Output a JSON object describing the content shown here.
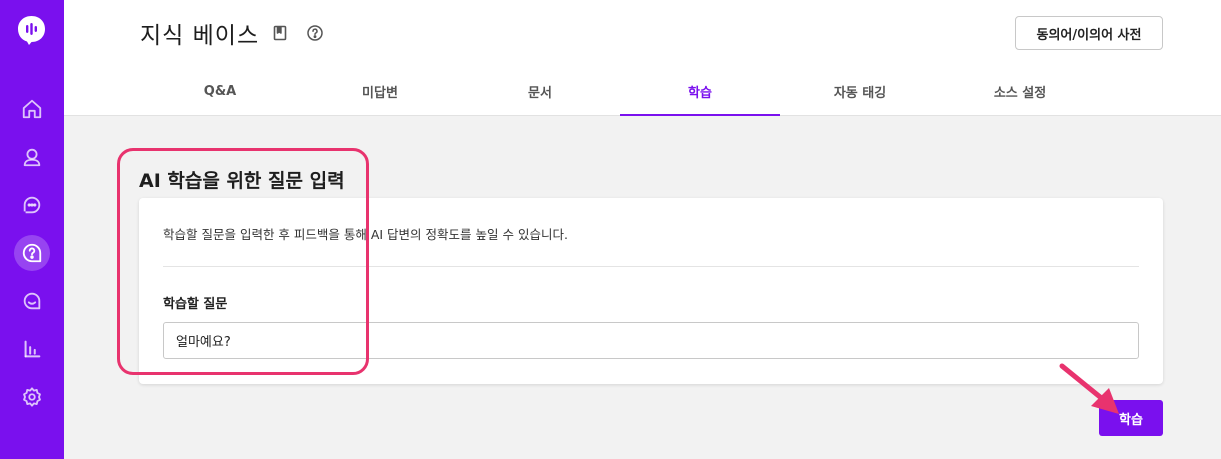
{
  "app": {
    "brand_color": "#7a10ee",
    "annotation_color": "#e8336e"
  },
  "sidebar": {
    "logo_icon": "chat-bubble-logo-icon",
    "items": [
      {
        "icon": "home-icon",
        "active": false
      },
      {
        "icon": "user-icon",
        "active": false
      },
      {
        "icon": "chat-icon",
        "active": false
      },
      {
        "icon": "knowledge-question-icon",
        "active": true
      },
      {
        "icon": "message-icon",
        "active": false
      },
      {
        "icon": "bar-chart-icon",
        "active": false
      },
      {
        "icon": "gear-icon",
        "active": false
      }
    ]
  },
  "header": {
    "title": "지식 베이스",
    "book_icon": "book-icon",
    "help_icon": "help-circle-icon",
    "dictionary_button": "동의어/이의어 사전"
  },
  "tabs": [
    {
      "label": "Q&A",
      "active": false
    },
    {
      "label": "미답변",
      "active": false
    },
    {
      "label": "문서",
      "active": false
    },
    {
      "label": "학습",
      "active": true
    },
    {
      "label": "자동 태깅",
      "active": false
    },
    {
      "label": "소스 설정",
      "active": false
    }
  ],
  "main": {
    "section_title": "AI 학습을 위한 질문 입력",
    "description": "학습할 질문을 입력한 후 피드백을 통해 AI 답변의 정확도를 높일 수 있습니다.",
    "question_label": "학습할 질문",
    "question_value": "얼마예요?",
    "train_button": "학습"
  }
}
